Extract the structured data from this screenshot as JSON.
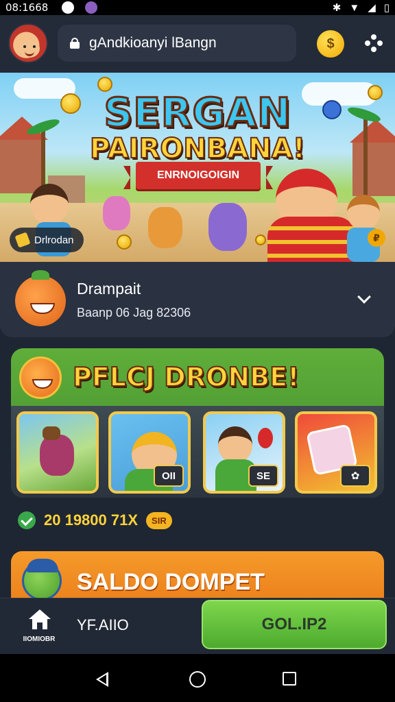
{
  "status_bar": {
    "time": "08:1668"
  },
  "header": {
    "search_text": "gAndkioanyi lBangn",
    "coin_symbol": "$"
  },
  "banner": {
    "title_line1": "SERGAN",
    "title_line2": "PAIRONBANA!",
    "ribbon": "ENRNOIGOIGIN",
    "chip_label": "Drlrodan"
  },
  "account": {
    "name": "Drampait",
    "subtitle": "Baanp 06 Jag 82306"
  },
  "promo": {
    "title": "PFLCJ DRONBE!",
    "games": [
      {
        "name": "game-runner",
        "badge": ""
      },
      {
        "name": "game-builder",
        "badge": "OII"
      },
      {
        "name": "game-balloon",
        "badge": "SE"
      },
      {
        "name": "game-cube",
        "badge": ""
      }
    ]
  },
  "stats": {
    "value": "20 19800 71X",
    "pill": "SIR"
  },
  "saldo": {
    "title": "SALDO DOMPET"
  },
  "bottom_bar": {
    "home_label": "IIOMIOBR",
    "mid_label": "YF.AIIO",
    "cta_label": "GOL.IP2"
  },
  "colors": {
    "cta": "#5fbf3a",
    "accent": "#ffd43a",
    "saldo": "#f08a22"
  }
}
